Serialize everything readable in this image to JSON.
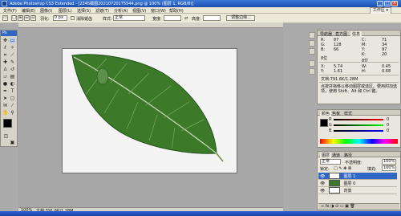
{
  "window": {
    "title": "Adobe Photoshop CS3 Extended - [2345截图20210720175544.png @ 100% (图层 1, RGB/8)]",
    "controls": [
      "_",
      "□",
      "×"
    ]
  },
  "menu": {
    "items": [
      "文件(F)",
      "编辑(E)",
      "图像(I)",
      "图层(L)",
      "选择(S)",
      "滤镜(T)",
      "分析(A)",
      "视图(V)",
      "窗口(W)",
      "帮助(H)"
    ],
    "workspace": "工作区 ▾"
  },
  "options": {
    "feather_label": "羽化:",
    "feather_value": "0 px",
    "antialias_label": "消除锯齿",
    "style_label": "样式:",
    "style_value": "正常",
    "width_label": "宽度:",
    "height_label": "高度:",
    "refine_label": "调整边缘..."
  },
  "toolbox": {
    "title": "Ps"
  },
  "document": {
    "zoom_status": "100%",
    "doc_info": "文档:791.6K/1.28M"
  },
  "info_panel": {
    "tabs": [
      "导航器",
      "直方图",
      "信息"
    ],
    "rgb": {
      "R": "87",
      "G": "128",
      "B": "66"
    },
    "cmyk": {
      "C": "71",
      "M": "34",
      "Y": "97",
      "K": "20"
    },
    "bit_left": "8位",
    "bit_right": "8位",
    "x": "5.74",
    "y": "1.61",
    "w": "0.45",
    "h": "0.68",
    "doc": "文档:791.6K/1.28M",
    "hint": "点按并拖移以移动图层或选区。要用附加选项，使用 Shift、Alt 和 Ctrl 键。"
  },
  "color_panel": {
    "tabs": [
      "颜色",
      "色板",
      "样式"
    ],
    "r": "0",
    "g": "0",
    "b": "0"
  },
  "layers_panel": {
    "tabs": [
      "图层",
      "通道",
      "路径"
    ],
    "blend": "正常",
    "opacity_label": "不透明度:",
    "opacity": "100%",
    "lock_label": "锁定:",
    "fill_label": "填充:",
    "fill": "100%",
    "layers": [
      {
        "name": "图层 1"
      },
      {
        "name": "图层 0"
      },
      {
        "name": "背景"
      }
    ]
  },
  "colors": {
    "accent": "#3166c4",
    "leaf": "#3c7a2a",
    "leaf_dark": "#24521a",
    "canvas": "#f4f4f4"
  }
}
